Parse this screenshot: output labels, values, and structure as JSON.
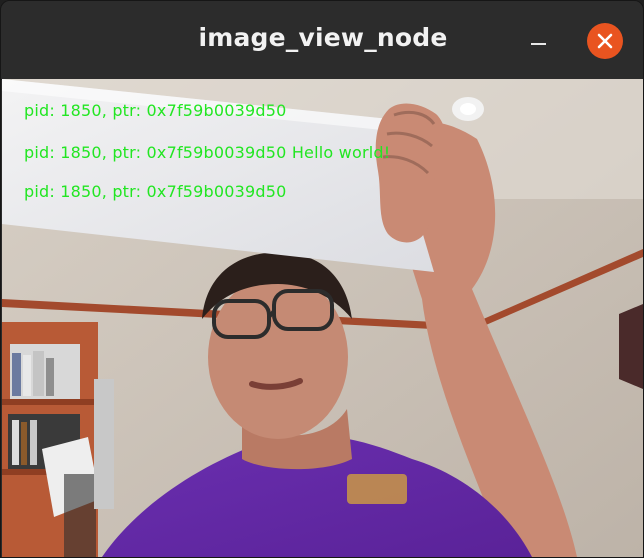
{
  "window": {
    "title": "image_view_node",
    "controls": {
      "minimize_icon": "minimize-icon",
      "close_icon": "close-icon",
      "close_color": "#e95420"
    }
  },
  "image": {
    "overlay_lines": [
      "pid: 1850, ptr: 0x7f59b0039d50",
      "pid: 1850, ptr: 0x7f59b0039d50 Hello world!",
      "pid: 1850, ptr: 0x7f59b0039d50"
    ],
    "overlay_color": "#22e622"
  }
}
